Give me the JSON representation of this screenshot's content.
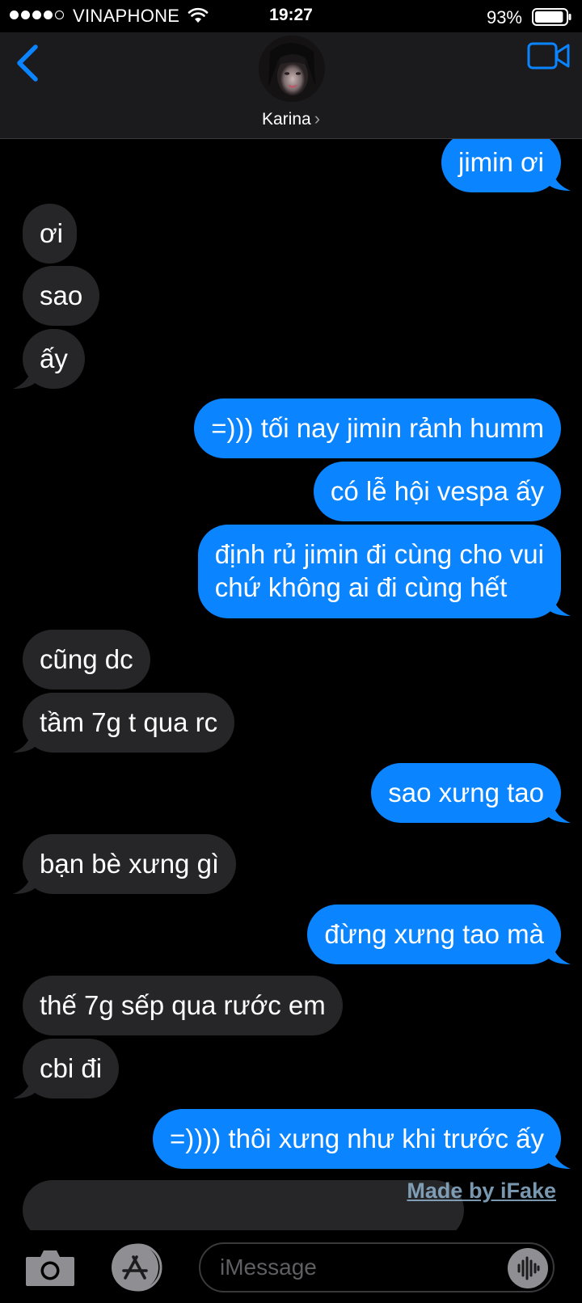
{
  "status_bar": {
    "carrier": "VINAPHONE",
    "time": "19:27",
    "battery_percent": "93%",
    "battery_level": 0.93,
    "signal_bars_filled": 4,
    "signal_bars_total": 5
  },
  "header": {
    "contact_name": "Karina",
    "chevron": "›",
    "back_icon": "chevron-left-icon",
    "video_icon": "video-camera-icon"
  },
  "messages": [
    {
      "side": "out",
      "text": "jimin ơi"
    },
    {
      "side": "in",
      "text": "ơi"
    },
    {
      "side": "in",
      "text": "sao"
    },
    {
      "side": "in",
      "text": "ấy"
    },
    {
      "side": "out",
      "text": "=))) tối nay jimin rảnh humm"
    },
    {
      "side": "out",
      "text": "có lễ hội vespa ấy"
    },
    {
      "side": "out",
      "text": "định rủ jimin đi cùng cho vui\nchứ không ai đi cùng hết"
    },
    {
      "side": "in",
      "text": "cũng dc"
    },
    {
      "side": "in",
      "text": "tầm 7g t qua rc"
    },
    {
      "side": "out",
      "text": "sao xưng tao"
    },
    {
      "side": "in",
      "text": "bạn bè xưng gì"
    },
    {
      "side": "out",
      "text": "đừng xưng tao mà"
    },
    {
      "side": "in",
      "text": "thế 7g sếp qua rước em"
    },
    {
      "side": "in",
      "text": "cbi đi"
    },
    {
      "side": "out",
      "text": "=)))) thôi xưng như khi trước ấy"
    },
    {
      "side": "in",
      "text": ""
    }
  ],
  "watermark": "Made by iFake",
  "composer": {
    "placeholder": "iMessage",
    "camera_icon": "camera-icon",
    "apps_icon": "app-store-icon",
    "audio_icon": "audio-waveform-icon"
  },
  "colors": {
    "outgoing_bubble": "#0a84ff",
    "incoming_bubble": "#262628",
    "accent": "#0a84ff",
    "background": "#000000",
    "header_background": "#1b1b1d"
  }
}
